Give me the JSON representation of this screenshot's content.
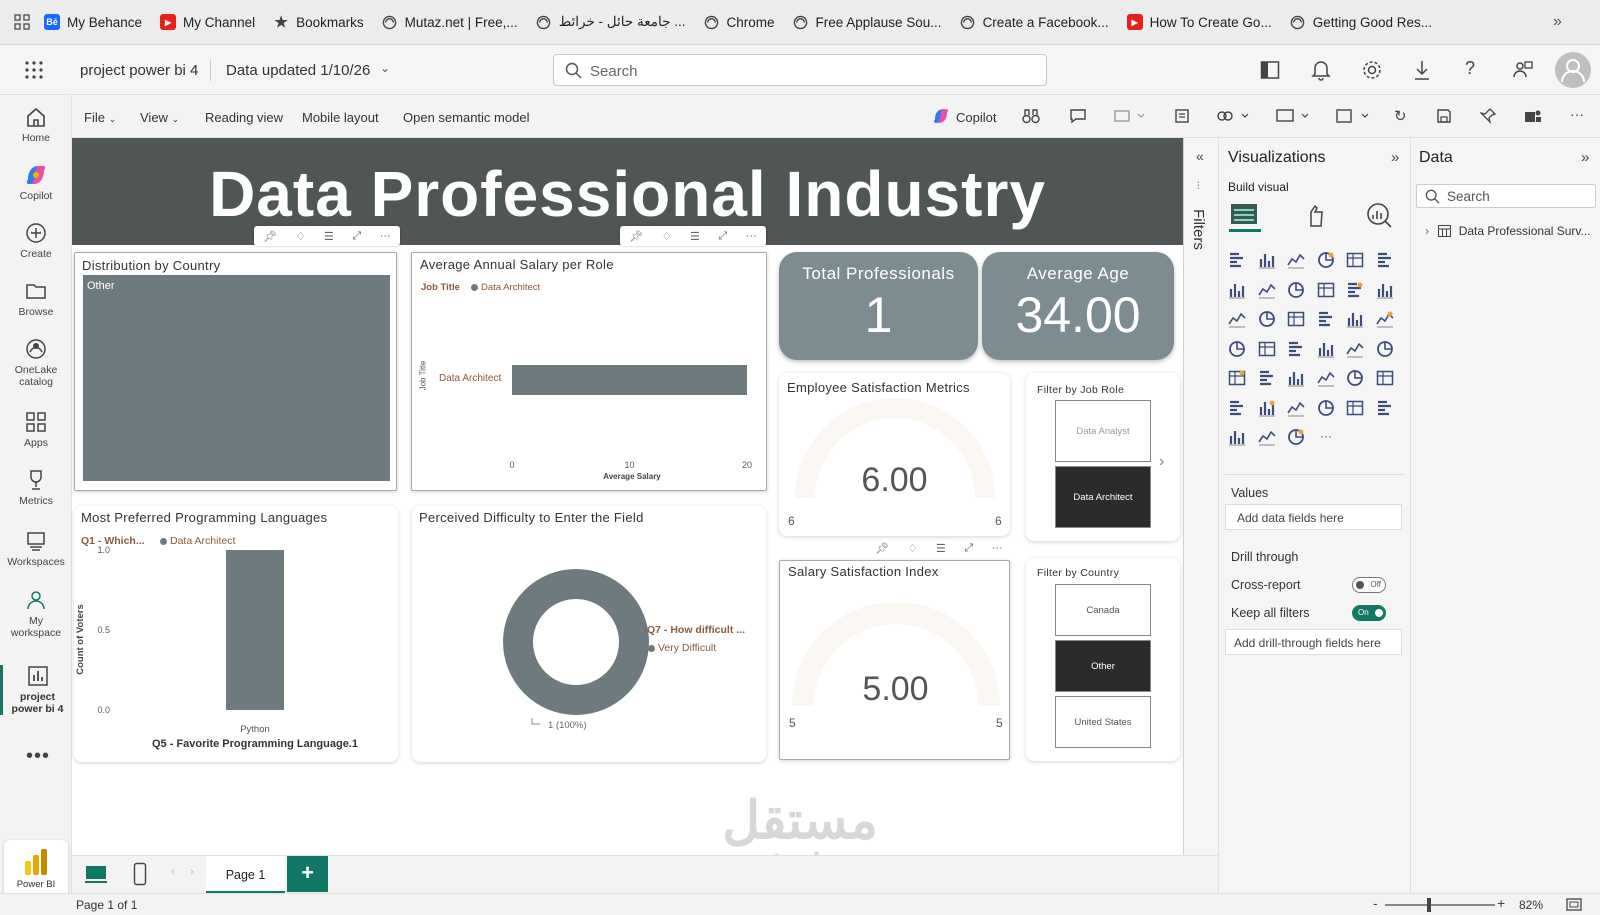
{
  "bookmarks": [
    {
      "label": "My Behance",
      "icon": "behance-icon"
    },
    {
      "label": "My Channel",
      "icon": "youtube-icon"
    },
    {
      "label": "Bookmarks",
      "icon": "star-icon"
    },
    {
      "label": "Mutaz.net | Free,...",
      "icon": "globe-icon"
    },
    {
      "label": "جامعة حائل - خرائط ...",
      "icon": "globe-icon"
    },
    {
      "label": "Chrome",
      "icon": "globe-icon"
    },
    {
      "label": "Free Applause Sou...",
      "icon": "globe-icon"
    },
    {
      "label": "Create a Facebook...",
      "icon": "globe-icon"
    },
    {
      "label": "How To Create Go...",
      "icon": "youtube-icon"
    },
    {
      "label": "Getting Good Res...",
      "icon": "globe-icon"
    }
  ],
  "appbar": {
    "report_name": "project power bi 4",
    "data_updated": "Data updated 1/10/26",
    "search_placeholder": "Search"
  },
  "leftnav": [
    {
      "label": "Home"
    },
    {
      "label": "Copilot"
    },
    {
      "label": "Create"
    },
    {
      "label": "Browse"
    },
    {
      "label": "OneLake catalog"
    },
    {
      "label": "Apps"
    },
    {
      "label": "Metrics"
    },
    {
      "label": "Workspaces"
    },
    {
      "label": "My workspace"
    },
    {
      "label": "project power bi 4"
    }
  ],
  "powerbi_label": "Power BI",
  "ribbon": {
    "file": "File",
    "view": "View",
    "reading_view": "Reading view",
    "mobile_layout": "Mobile layout",
    "open_semantic_model": "Open semantic model",
    "copilot": "Copilot"
  },
  "report": {
    "banner_title": "Data Professional Industry",
    "country_dist": {
      "title": "Distribution by Country",
      "category": "Other"
    },
    "salary_role": {
      "title": "Average Annual Salary per Role",
      "legend_title": "Job Title",
      "legend_item": "Data Architect",
      "y_axis_label": "Job Title",
      "x_axis_label": "Average Salary",
      "category": "Data Architect",
      "value": 20,
      "ticks": [
        "0",
        "10",
        "20"
      ]
    },
    "kpi_total": {
      "label": "Total Professionals",
      "value": "1"
    },
    "kpi_age": {
      "label": "Average Age",
      "value": "34.00"
    },
    "satisfaction": {
      "title": "Employee Satisfaction Metrics",
      "value": "6.00",
      "min": "6",
      "max": "6"
    },
    "salary_index": {
      "title": "Salary Satisfaction Index",
      "value": "5.00",
      "min": "5",
      "max": "5"
    },
    "filter_role": {
      "title": "Filter by Job Role",
      "options": [
        {
          "label": "Data Analyst",
          "selected": false
        },
        {
          "label": "Data Architect",
          "selected": true
        }
      ]
    },
    "filter_country": {
      "title": "Filter by Country",
      "options": [
        {
          "label": "Canada",
          "selected": false
        },
        {
          "label": "Other",
          "selected": true
        },
        {
          "label": "United States",
          "selected": false
        }
      ]
    },
    "prog_lang": {
      "title": "Most Preferred Programming Languages",
      "legend_title": "Q1 - Which...",
      "legend_item": "Data Architect",
      "y_axis_label": "Count of Voters",
      "x_axis_label": "Q5 - Favorite Programming Language.1",
      "category": "Python",
      "value": 1.0,
      "ticks": [
        "1.0",
        "0.5",
        "0.0"
      ]
    },
    "difficulty": {
      "title": "Perceived Difficulty to Enter the Field",
      "legend_title": "Q7 - How difficult ...",
      "legend_item": "Very Difficult",
      "data_label": "1 (100%)"
    }
  },
  "chart_data": [
    {
      "type": "pie",
      "title": "Distribution by Country",
      "categories": [
        "Other"
      ],
      "values": [
        1
      ]
    },
    {
      "type": "bar",
      "title": "Average Annual Salary per Role",
      "categories": [
        "Data Architect"
      ],
      "values": [
        20
      ],
      "xlabel": "Average Salary",
      "ylabel": "Job Title",
      "xlim": [
        0,
        20
      ]
    },
    {
      "type": "bar",
      "title": "Most Preferred Programming Languages",
      "categories": [
        "Python"
      ],
      "values": [
        1.0
      ],
      "xlabel": "Q5 - Favorite Programming Language.1",
      "ylabel": "Count of Voters",
      "ylim": [
        0,
        1.0
      ]
    },
    {
      "type": "pie",
      "title": "Perceived Difficulty to Enter the Field",
      "categories": [
        "Very Difficult"
      ],
      "values": [
        1
      ]
    }
  ],
  "filters_label": "Filters",
  "vispane": {
    "title": "Visualizations",
    "build_visual": "Build visual",
    "values_label": "Values",
    "add_data_fields": "Add data fields here",
    "drill_through": "Drill through",
    "cross_report": "Cross-report",
    "cross_report_state": "Off",
    "keep_all_filters": "Keep all filters",
    "keep_all_filters_state": "On",
    "add_drill_fields": "Add drill-through fields here"
  },
  "datapane": {
    "title": "Data",
    "search_placeholder": "Search",
    "table_name": "Data Professional Surv..."
  },
  "tabs": {
    "page1": "Page 1",
    "add": "+"
  },
  "status": {
    "page_info": "Page 1 of 1",
    "zoom": "82%"
  },
  "watermark": {
    "arabic": "مستقل",
    "latin": "mostaql.com"
  },
  "colors": {
    "accent": "#117865",
    "bar": "#6e7b7e",
    "kpi": "#7d8c91",
    "banner": "#505555",
    "selected": "#2b2b2b"
  }
}
